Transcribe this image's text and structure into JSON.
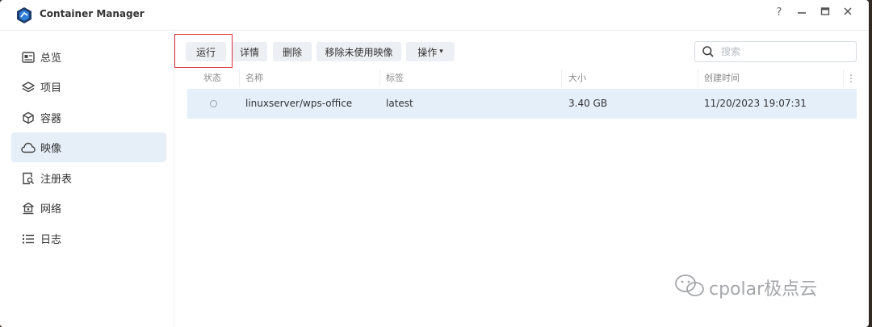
{
  "window": {
    "title": "Container Manager",
    "controls": {
      "help": "?",
      "minimize": "—",
      "maximize": "□",
      "close": "✕"
    }
  },
  "sidebar": {
    "items": [
      {
        "label": "总览",
        "icon": "overview-card-icon"
      },
      {
        "label": "项目",
        "icon": "layers-icon"
      },
      {
        "label": "容器",
        "icon": "cube-icon"
      },
      {
        "label": "映像",
        "icon": "cloud-icon",
        "active": true
      },
      {
        "label": "注册表",
        "icon": "registry-search-icon"
      },
      {
        "label": "网络",
        "icon": "network-home-icon"
      },
      {
        "label": "日志",
        "icon": "list-icon"
      }
    ]
  },
  "toolbar": {
    "run_label": "运行",
    "details_label": "详情",
    "delete_label": "删除",
    "remove_unused_label": "移除未使用映像",
    "actions_label": "操作",
    "actions_caret": "▾"
  },
  "search": {
    "placeholder": "搜索",
    "value": ""
  },
  "table": {
    "columns": [
      "状态",
      "名称",
      "标签",
      "大小",
      "创建时间"
    ],
    "menu_glyph": "⋮",
    "rows": [
      {
        "name": "linuxserver/wps-office",
        "tag": "latest",
        "size": "3.40 GB",
        "created": "11/20/2023 19:07:31"
      }
    ]
  },
  "watermark": {
    "text": "cpolar极点云"
  },
  "colors": {
    "selected_row": "#e5effa",
    "active_nav": "#e6eef8",
    "highlight_border": "#d9303a",
    "button_bg": "#eceff3"
  }
}
